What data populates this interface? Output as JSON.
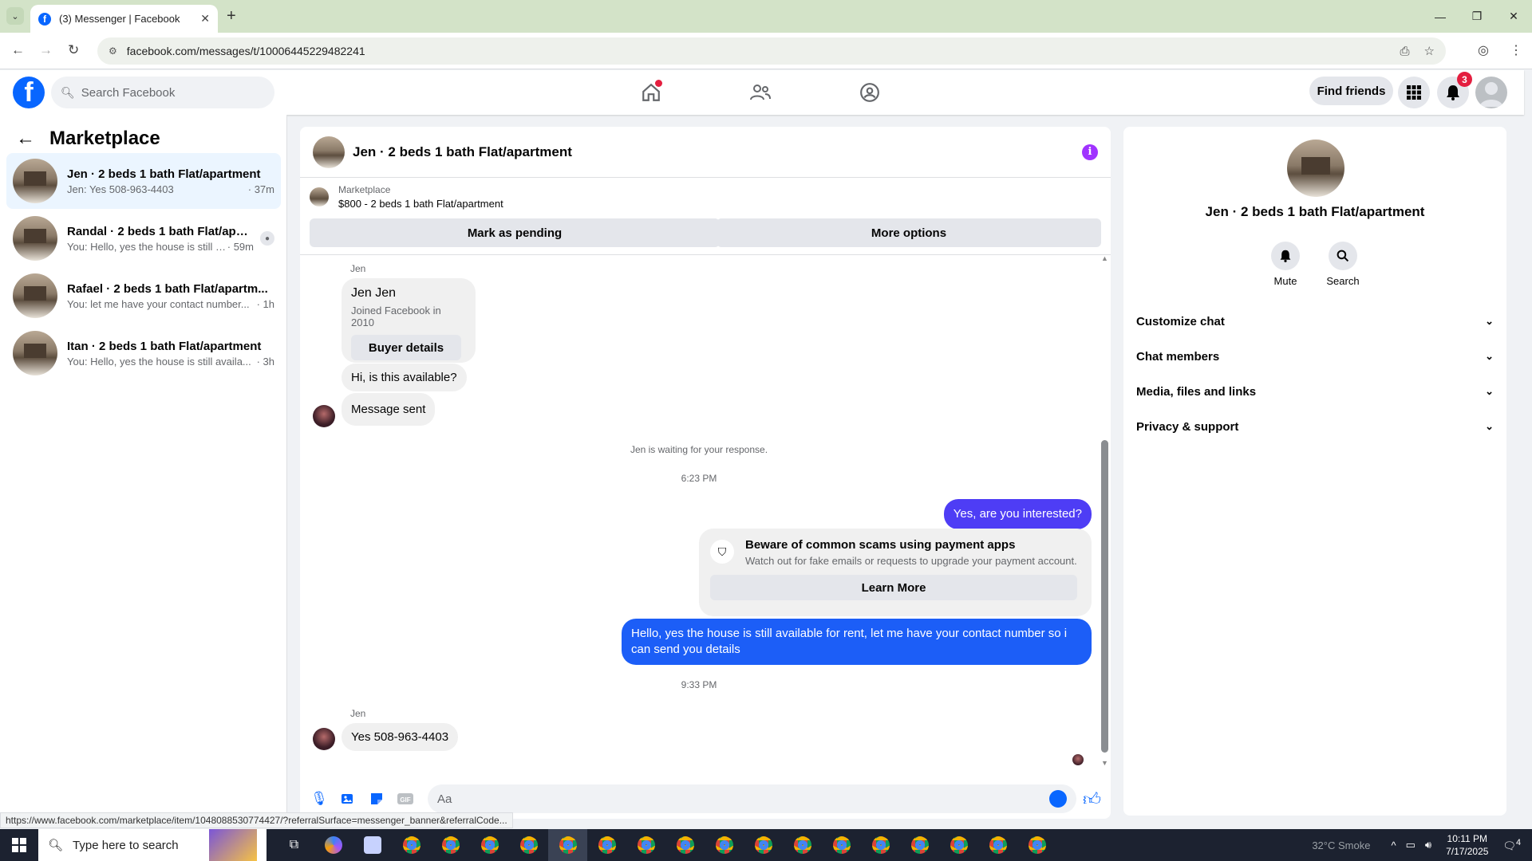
{
  "browser": {
    "tab_title": "(3) Messenger | Facebook",
    "url": "facebook.com/messages/t/10006445229482241",
    "status_link": "https://www.facebook.com/marketplace/item/1048088530774427/?referralSurface=messenger_banner&referralCode..."
  },
  "fb_header": {
    "search_placeholder": "Search Facebook",
    "find_friends": "Find friends",
    "notification_count": "3"
  },
  "left": {
    "title": "Marketplace",
    "conversations": [
      {
        "name": "Jen · 2 beds 1 bath Flat/apartment",
        "preview": "Jen: Yes 508-963-4403",
        "time": " · 37m"
      },
      {
        "name": "Randal · 2 beds 1 bath Flat/apart...",
        "preview": "You: Hello, yes the house is still a...",
        "time": " · 59m"
      },
      {
        "name": "Rafael · 2 beds 1 bath Flat/apartm...",
        "preview": "You: let me have your contact number...",
        "time": " · 1h"
      },
      {
        "name": "Itan · 2 beds 1 bath Flat/apartment",
        "preview": "You: Hello, yes the house is still availa...",
        "time": " · 3h"
      }
    ]
  },
  "chat": {
    "title": "Jen · 2 beds 1 bath Flat/apartment",
    "listing_source": "Marketplace",
    "listing_desc": "$800 - 2 beds 1 bath Flat/apartment",
    "mark_pending": "Mark as pending",
    "more_options": "More options",
    "sender_label": "Jen",
    "profile_name": "Jen Jen",
    "profile_joined": "Joined Facebook in 2010",
    "buyer_details": "Buyer details",
    "msg_available": "Hi, is this available?",
    "msg_sent": "Message sent",
    "waiting_note": "Jen is waiting for your response.",
    "time1": "6:23 PM",
    "out1": "Yes, are you interested?",
    "scam_title": "Beware of common scams using payment apps",
    "scam_desc": "Watch out for fake emails or requests to upgrade your payment account.",
    "learn_more": "Learn More",
    "out2_line1": "Hello, yes the house is still available for rent, let me have your contact number so i",
    "out2_line2": "can send you details",
    "time2": "9:33 PM",
    "sender_label2": "Jen",
    "in_last": "Yes 508-963-4403",
    "composer_placeholder": "Aa"
  },
  "right": {
    "name": "Jen · 2 beds 1 bath Flat/apartment",
    "mute": "Mute",
    "search": "Search",
    "sections": [
      "Customize chat",
      "Chat members",
      "Media, files and links",
      "Privacy & support"
    ]
  },
  "taskbar": {
    "search_placeholder": "Type here to search",
    "weather": "32°C  Smoke",
    "time": "10:11 PM",
    "date": "7/17/2025",
    "notif_count": "4"
  }
}
